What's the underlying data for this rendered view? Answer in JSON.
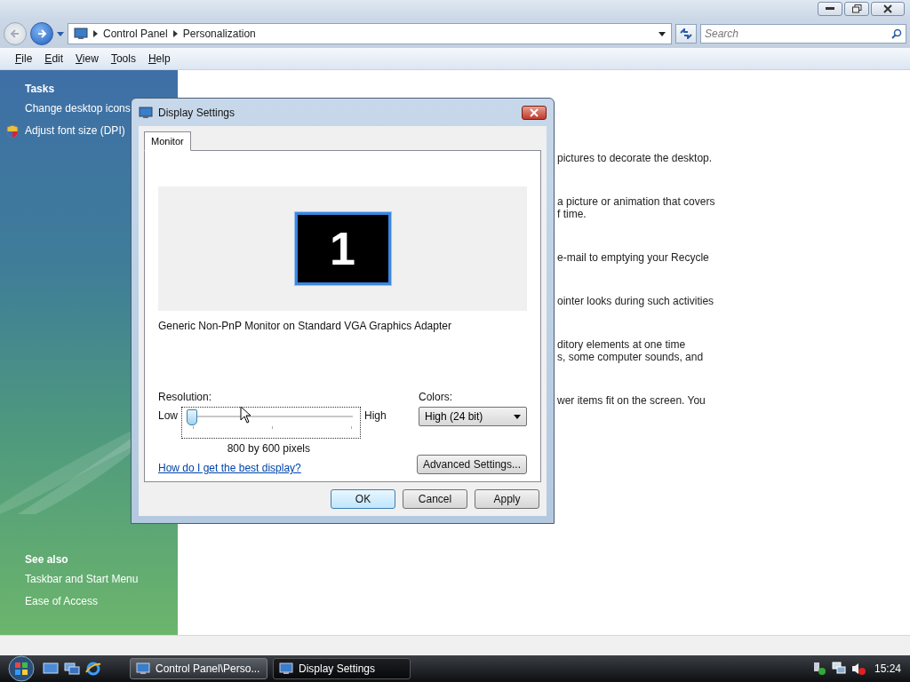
{
  "address_bar": {
    "breadcrumbs": [
      "Control Panel",
      "Personalization"
    ],
    "search": {
      "placeholder": "Search"
    }
  },
  "menu_bar": [
    {
      "label": "File"
    },
    {
      "label": "Edit"
    },
    {
      "label": "View"
    },
    {
      "label": "Tools"
    },
    {
      "label": "Help"
    }
  ],
  "sidebar": {
    "tasks_heading": "Tasks",
    "tasks": [
      {
        "label": "Change desktop icons",
        "shield": false
      },
      {
        "label": "Adjust font size (DPI)",
        "shield": true
      }
    ],
    "see_also_heading": "See also",
    "see_also": [
      "Taskbar and Start Menu",
      "Ease of Access"
    ]
  },
  "content": {
    "fragments": [
      [
        "pictures to decorate the desktop."
      ],
      [
        "a picture or animation that covers",
        "f time."
      ],
      [
        "e-mail to emptying your Recycle"
      ],
      [
        "ointer looks during such activities"
      ],
      [
        "ditory elements at one time",
        "s, some computer sounds, and"
      ],
      [
        "wer items fit on the screen. You"
      ]
    ]
  },
  "dialog": {
    "title": "Display Settings",
    "tabs": [
      {
        "label": "Monitor",
        "selected": true
      }
    ],
    "monitor_number": "1",
    "monitor_name": "Generic Non-PnP Monitor on Standard VGA Graphics Adapter",
    "resolution": {
      "label": "Resolution:",
      "low": "Low",
      "high": "High",
      "level": 0,
      "reading": "800 by 600 pixels"
    },
    "colors": {
      "label": "Colors:",
      "value": "High (24 bit)"
    },
    "help_link": "How do I get the best display?",
    "advanced_button": "Advanced Settings...",
    "buttons": [
      {
        "label": "OK",
        "default": true
      },
      {
        "label": "Cancel",
        "default": false
      },
      {
        "label": "Apply",
        "default": false
      }
    ]
  },
  "taskbar": {
    "tasks": [
      {
        "label": "Control Panel\\Perso...",
        "selected": false
      },
      {
        "label": "Display Settings",
        "selected": true
      }
    ],
    "clock": "15:24"
  }
}
